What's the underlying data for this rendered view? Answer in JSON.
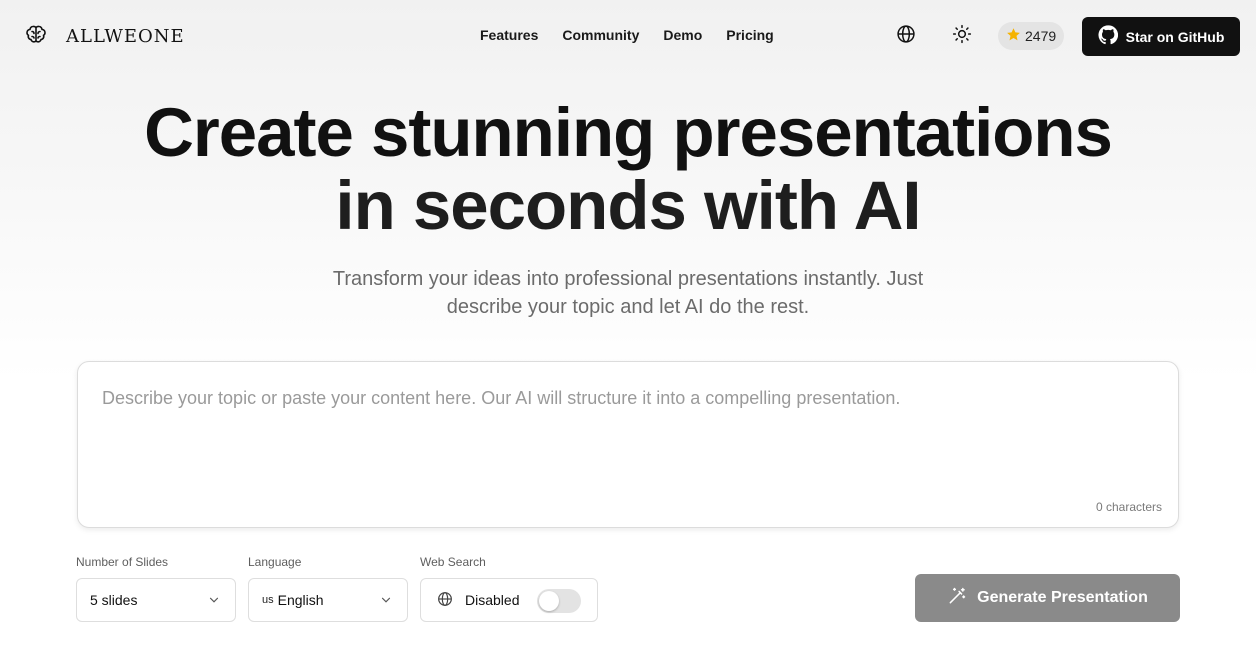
{
  "header": {
    "logo_text": "ALLWEONE",
    "nav": [
      "Features",
      "Community",
      "Demo",
      "Pricing"
    ],
    "star_count": "2479",
    "github_label": "Star on GitHub"
  },
  "hero": {
    "title_line1": "Create stunning presentations",
    "title_line2": "in seconds with AI",
    "subtitle": "Transform your ideas into professional presentations instantly. Just describe your topic and let AI do the rest."
  },
  "input": {
    "placeholder": "Describe your topic or paste your content here. Our AI will structure it into a compelling presentation.",
    "value": "",
    "char_count": "0 characters"
  },
  "controls": {
    "slides_label": "Number of Slides",
    "slides_value": "5 slides",
    "language_label": "Language",
    "language_flag": "us",
    "language_value": "English",
    "web_search_label": "Web Search",
    "web_search_value": "Disabled",
    "web_search_enabled": false,
    "generate_label": "Generate Presentation"
  },
  "colors": {
    "primary_dark": "#111111",
    "badge_bg": "#e4e4e4",
    "star": "#f5b301",
    "generate_disabled": "#8a8a8a"
  },
  "icons": {
    "logo": "brain-icon",
    "language": "globe-icon",
    "theme": "sun-icon",
    "star": "star-icon",
    "github": "github-icon",
    "generate": "magic-wand-icon"
  }
}
